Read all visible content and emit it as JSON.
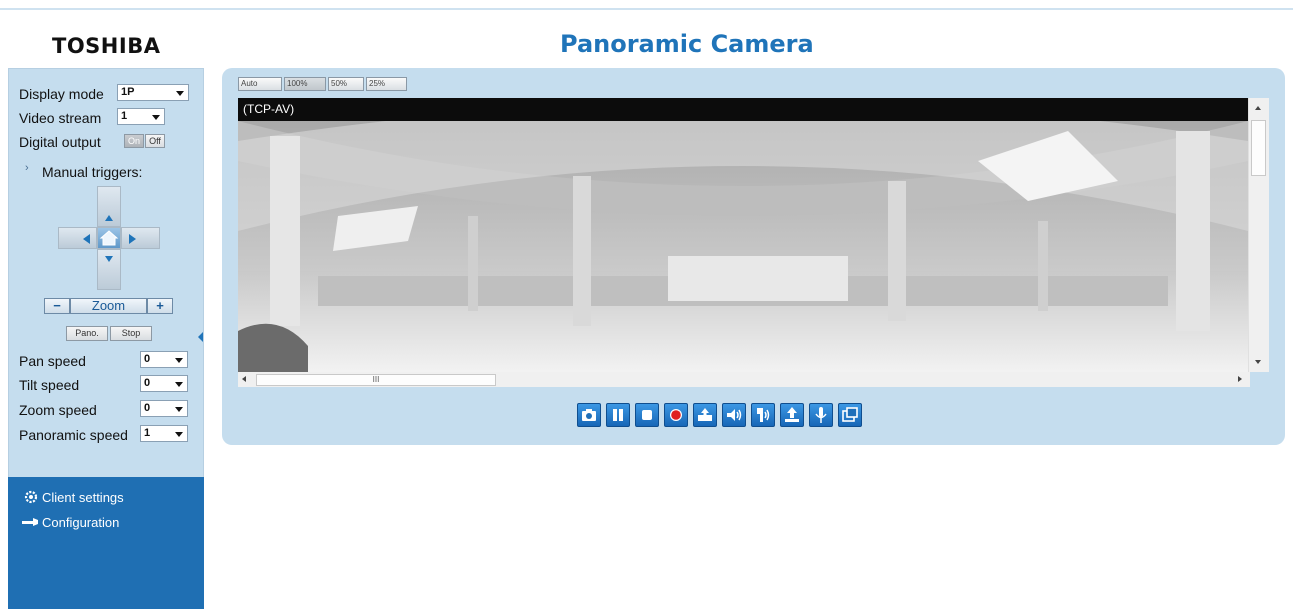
{
  "header": {
    "brand": "TOSHIBA",
    "title": "Panoramic Camera"
  },
  "sidebar": {
    "display_mode": {
      "label": "Display mode",
      "value": "1P"
    },
    "video_stream": {
      "label": "Video stream",
      "value": "1"
    },
    "digital_output": {
      "label": "Digital output",
      "on": "On",
      "off": "Off"
    },
    "manual_triggers": "Manual triggers:",
    "zoom_label": "Zoom",
    "zoom_minus": "−",
    "zoom_plus": "+",
    "pano_btn": "Pano.",
    "stop_btn": "Stop",
    "pan_speed": {
      "label": "Pan speed",
      "value": "0"
    },
    "tilt_speed": {
      "label": "Tilt speed",
      "value": "0"
    },
    "zoom_speed": {
      "label": "Zoom speed",
      "value": "0"
    },
    "panoramic_speed": {
      "label": "Panoramic speed",
      "value": "1"
    },
    "client_settings": "Client settings",
    "configuration": "Configuration"
  },
  "viewer": {
    "size_buttons": [
      "Auto",
      "100%",
      "50%",
      "25%"
    ],
    "stream_label": "(TCP-AV)",
    "hscroll_grip": "III"
  },
  "controls": [
    {
      "icon": "camera-snapshot-icon"
    },
    {
      "icon": "pause-icon"
    },
    {
      "icon": "stop-icon"
    },
    {
      "icon": "record-icon"
    },
    {
      "icon": "upload-folder-icon"
    },
    {
      "icon": "speaker-icon"
    },
    {
      "icon": "talk-icon"
    },
    {
      "icon": "upload-icon"
    },
    {
      "icon": "microphone-icon"
    },
    {
      "icon": "fullscreen-icon"
    }
  ],
  "colors": {
    "accent": "#1f74b9",
    "panel": "#c5ddee",
    "sidebar_footer": "#1f6fb3",
    "record": "#e02020"
  }
}
